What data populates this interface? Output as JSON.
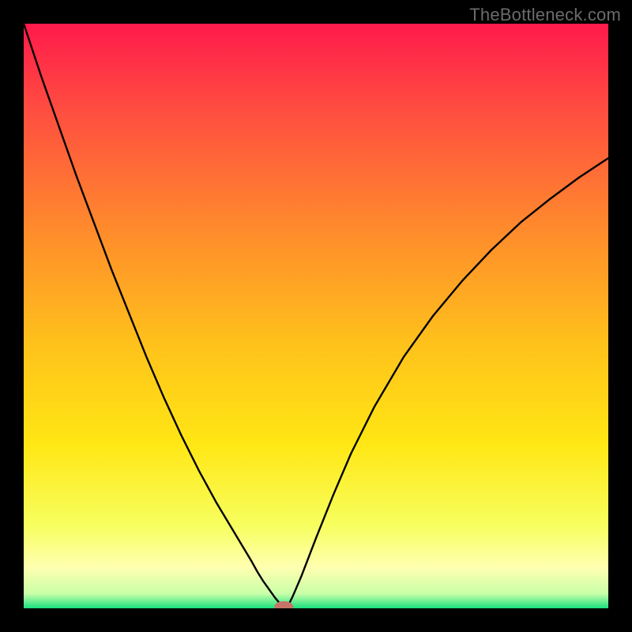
{
  "watermark": "TheBottleneck.com",
  "chart_data": {
    "type": "line",
    "title": "",
    "xlabel": "",
    "ylabel": "",
    "xlim": [
      0,
      1
    ],
    "ylim": [
      0,
      1
    ],
    "grid": false,
    "legend": false,
    "background": {
      "type": "vertical-gradient",
      "stops": [
        {
          "pos": 0.0,
          "color": "#ff1a4b"
        },
        {
          "pos": 0.15,
          "color": "#ff4e40"
        },
        {
          "pos": 0.35,
          "color": "#ff8a2c"
        },
        {
          "pos": 0.55,
          "color": "#ffc21b"
        },
        {
          "pos": 0.72,
          "color": "#ffe714"
        },
        {
          "pos": 0.86,
          "color": "#f7ff60"
        },
        {
          "pos": 0.93,
          "color": "#ffffb0"
        },
        {
          "pos": 0.975,
          "color": "#c9ffa8"
        },
        {
          "pos": 1.0,
          "color": "#19e07e"
        }
      ]
    },
    "marker": {
      "x": 0.445,
      "y": 0.0,
      "color": "#c77468",
      "shape": "capsule"
    },
    "series": [
      {
        "name": "bottleneck-curve",
        "color": "#000000",
        "x": [
          0.0,
          0.03,
          0.06,
          0.09,
          0.12,
          0.15,
          0.18,
          0.21,
          0.24,
          0.27,
          0.3,
          0.33,
          0.36,
          0.39,
          0.4,
          0.41,
          0.42,
          0.43,
          0.44,
          0.445,
          0.45,
          0.455,
          0.46,
          0.475,
          0.5,
          0.53,
          0.56,
          0.6,
          0.65,
          0.7,
          0.75,
          0.8,
          0.85,
          0.9,
          0.95,
          1.0
        ],
        "y": [
          1.0,
          0.91,
          0.825,
          0.74,
          0.66,
          0.58,
          0.505,
          0.43,
          0.36,
          0.295,
          0.235,
          0.18,
          0.13,
          0.08,
          0.062,
          0.046,
          0.032,
          0.018,
          0.006,
          0.0,
          0.003,
          0.01,
          0.02,
          0.055,
          0.12,
          0.195,
          0.265,
          0.345,
          0.43,
          0.5,
          0.56,
          0.613,
          0.66,
          0.7,
          0.737,
          0.77
        ]
      }
    ]
  }
}
